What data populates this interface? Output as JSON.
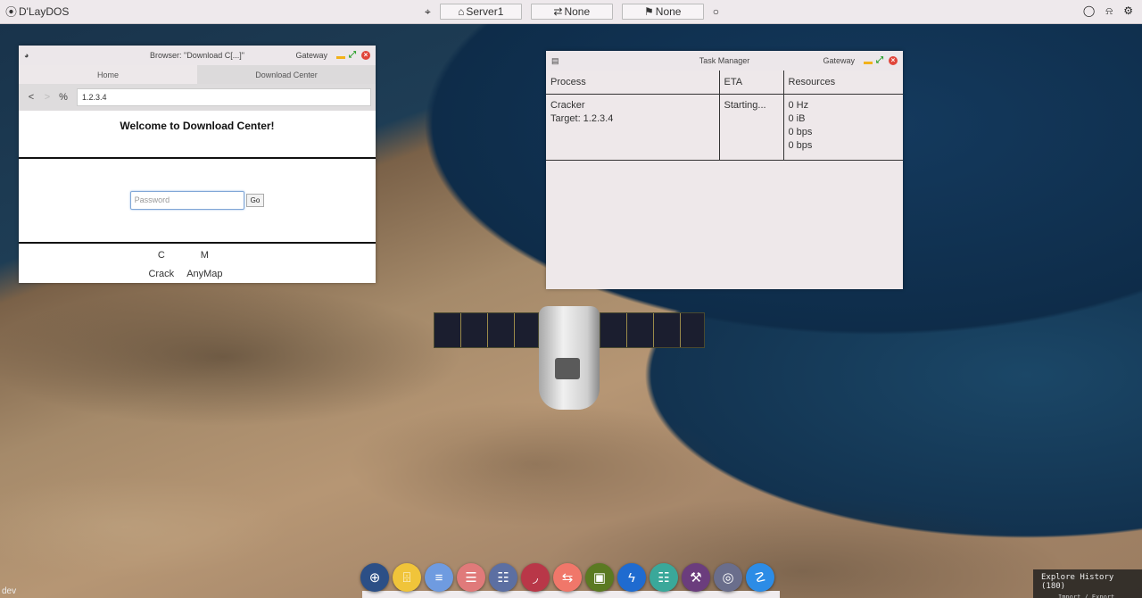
{
  "app": {
    "brand": "D'LayDOS",
    "env_label": "dev"
  },
  "topbar": {
    "server_btn": "Server1",
    "connection_btn": "None",
    "flag_btn": "None"
  },
  "browser": {
    "title": "Browser: \"Download C[...]\"",
    "owner": "Gateway",
    "tabs": [
      "Home",
      "Download Center"
    ],
    "nav": {
      "back": "<",
      "forward": ">",
      "percent": "%"
    },
    "address": "1.2.3.4",
    "welcome": "Welcome to Download Center!",
    "password_placeholder": "Password",
    "go_label": "Go",
    "apps": [
      {
        "glyph": "C",
        "label": "Crack"
      },
      {
        "glyph": "M",
        "label": "AnyMap"
      }
    ]
  },
  "taskmanager": {
    "title": "Task Manager",
    "owner": "Gateway",
    "columns": [
      "Process",
      "ETA",
      "Resources"
    ],
    "rows": [
      {
        "process": "Cracker",
        "target": "Target: 1.2.3.4",
        "eta": "Starting...",
        "resources": [
          "0 Hz",
          "0 iB",
          "0 bps",
          "0 bps"
        ]
      }
    ]
  },
  "dock": {
    "items": [
      {
        "name": "browser",
        "color": "#2c4f86",
        "glyph": "⊕"
      },
      {
        "name": "files",
        "color": "#f0c43a",
        "glyph": "⌹"
      },
      {
        "name": "notes",
        "color": "#6f9be0",
        "glyph": "≡"
      },
      {
        "name": "logs",
        "color": "#e07a7a",
        "glyph": "☰"
      },
      {
        "name": "database",
        "color": "#5c6fa2",
        "glyph": "☷"
      },
      {
        "name": "network",
        "color": "#b93748",
        "glyph": "◞"
      },
      {
        "name": "transfer",
        "color": "#f0776a",
        "glyph": "⇆"
      },
      {
        "name": "finance",
        "color": "#5b7a22",
        "glyph": "▣"
      },
      {
        "name": "power",
        "color": "#1f6bd0",
        "glyph": "ϟ"
      },
      {
        "name": "settings-sliders",
        "color": "#3aa89a",
        "glyph": "☷"
      },
      {
        "name": "tools",
        "color": "#6b3d7d",
        "glyph": "⚒"
      },
      {
        "name": "podcast",
        "color": "#6a6e8c",
        "glyph": "◎"
      },
      {
        "name": "bug",
        "color": "#2c8ce6",
        "glyph": "☡"
      }
    ]
  },
  "explore": {
    "title": "Explore History (180)",
    "sub": "Import / Export"
  }
}
